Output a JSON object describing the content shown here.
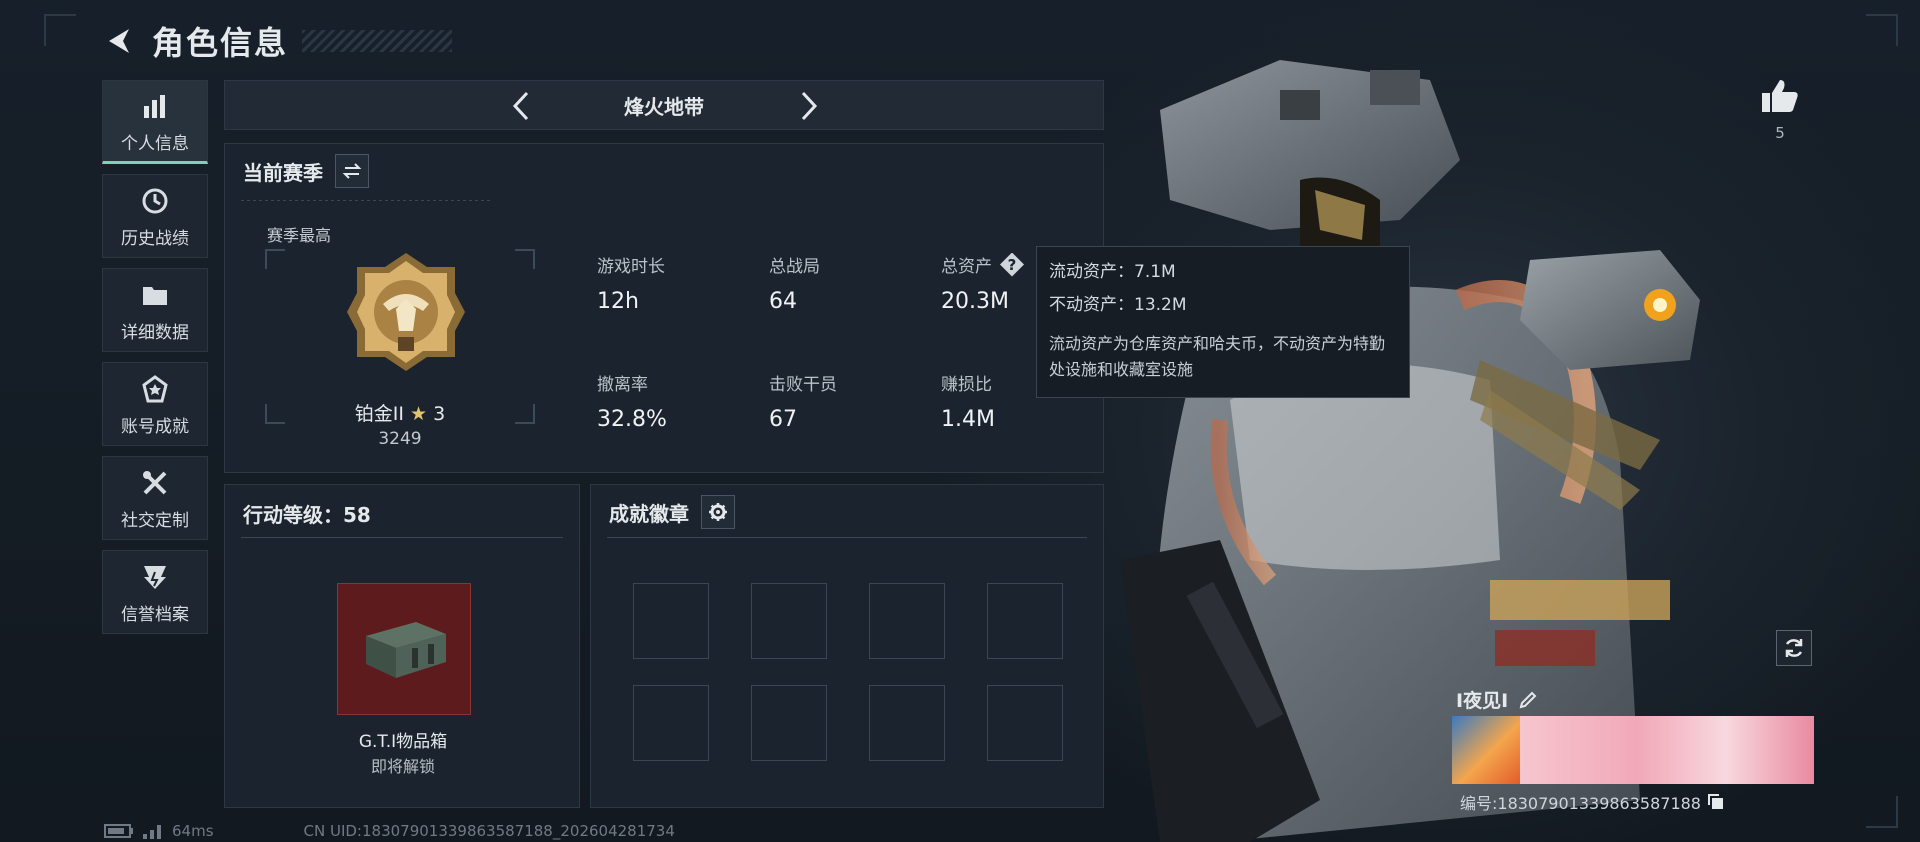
{
  "header": {
    "title": "角色信息"
  },
  "sidebar": {
    "items": [
      {
        "label": "个人信息",
        "icon": "bar-chart-icon",
        "active": true
      },
      {
        "label": "历史战绩",
        "icon": "clock-icon"
      },
      {
        "label": "详细数据",
        "icon": "folder-icon"
      },
      {
        "label": "账号成就",
        "icon": "achievement-icon"
      },
      {
        "label": "社交定制",
        "icon": "tools-icon"
      },
      {
        "label": "信誉档案",
        "icon": "shield-icon"
      }
    ]
  },
  "mode": {
    "name": "烽火地带"
  },
  "season": {
    "title": "当前赛季",
    "highest_label": "赛季最高",
    "rank_name": "铂金II",
    "rank_stars": "3",
    "rank_score": "3249",
    "stats": [
      {
        "label": "游戏时长",
        "value": "12h"
      },
      {
        "label": "总战局",
        "value": "64"
      },
      {
        "label": "总资产",
        "value": "20.3M"
      },
      {
        "label": "撤离率",
        "value": "32.8%"
      },
      {
        "label": "击败干员",
        "value": "67"
      },
      {
        "label": "赚损比",
        "value": "1.4M"
      }
    ]
  },
  "tooltip": {
    "liquid": "流动资产：7.1M",
    "fixed": "不动资产：13.2M",
    "desc": "流动资产为仓库资产和哈夫币，不动资产为特勤处设施和收藏室设施"
  },
  "level": {
    "title": "行动等级：58",
    "reward_name": "G.T.I物品箱",
    "reward_status": "即将解锁"
  },
  "badges": {
    "title": "成就徽章"
  },
  "social": {
    "likes": "5"
  },
  "character": {
    "name": "I夜见I",
    "id_text": "编号:1830790133986358718​8"
  },
  "footer": {
    "ping": "64ms",
    "uid": "CN UID:1830790133986358718​8_202604281734"
  },
  "colors": {
    "accent": "#7fd0b8",
    "crate": "#5e1b1d",
    "gold": "#c9a25a"
  }
}
